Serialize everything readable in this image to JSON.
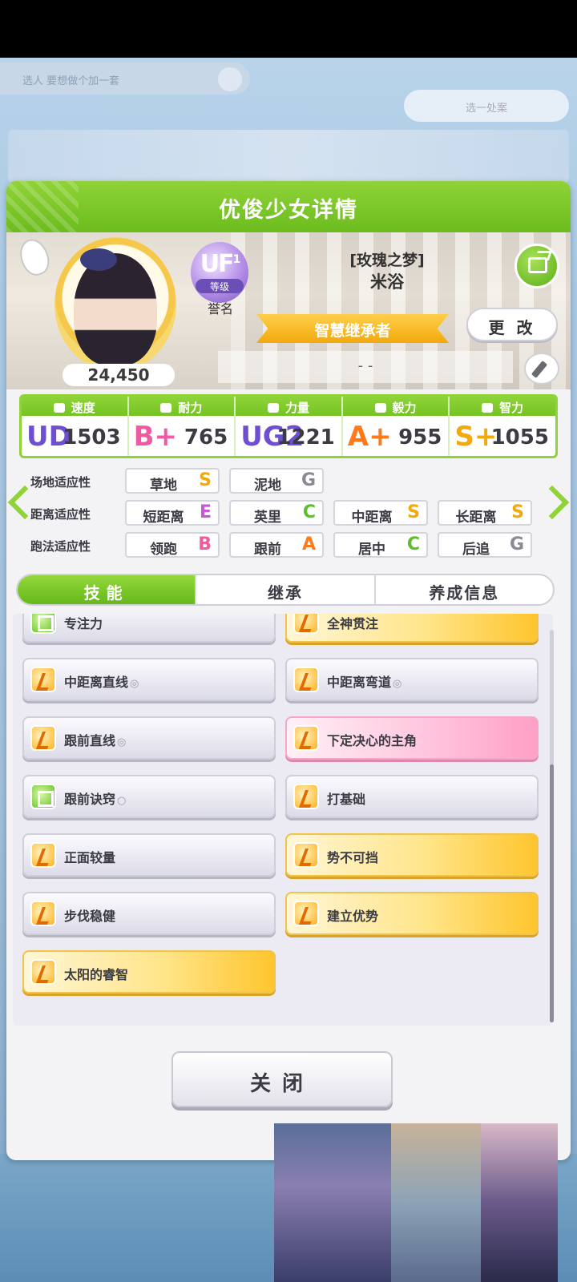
{
  "background": {
    "top_left_text": "选人 要想做个加一套",
    "top_right_button": "选一处案"
  },
  "dialog": {
    "title": "优俊少女详情"
  },
  "profile": {
    "fans": "24,450",
    "rank_badge": "UF",
    "rank_badge_sub": "1",
    "rank_label": "等级",
    "honor_label": "誉名",
    "epithet": "[玫瑰之梦]",
    "name": "米浴",
    "title": "智慧继承者",
    "change_button": "更 改",
    "motto": "- -"
  },
  "stats": [
    {
      "label": "速度",
      "grade": "UD",
      "value": "1503",
      "color": "#6e4fd1"
    },
    {
      "label": "耐力",
      "grade": "B+",
      "value": "765",
      "color": "#f05aa0"
    },
    {
      "label": "力量",
      "grade": "UG2",
      "value": "1221",
      "color": "#6e4fd1"
    },
    {
      "label": "毅力",
      "grade": "A+",
      "value": "955",
      "color": "#ff7a1a"
    },
    {
      "label": "智力",
      "grade": "S+",
      "value": "1055",
      "color": "#f2a90d"
    }
  ],
  "aptitude": {
    "rows": [
      {
        "label": "场地适应性",
        "cells": [
          {
            "name": "草地",
            "grade": "S",
            "color": "#f2a90d"
          },
          {
            "name": "泥地",
            "grade": "G",
            "color": "#8a8a96"
          }
        ]
      },
      {
        "label": "距离适应性",
        "cells": [
          {
            "name": "短距离",
            "grade": "E",
            "color": "#c45ad6"
          },
          {
            "name": "英里",
            "grade": "C",
            "color": "#5fbf2a"
          },
          {
            "name": "中距离",
            "grade": "S",
            "color": "#f2a90d"
          },
          {
            "name": "长距离",
            "grade": "S",
            "color": "#f2a90d"
          }
        ]
      },
      {
        "label": "跑法适应性",
        "cells": [
          {
            "name": "领跑",
            "grade": "B",
            "color": "#f05aa0"
          },
          {
            "name": "跟前",
            "grade": "A",
            "color": "#ff7a1a"
          },
          {
            "name": "居中",
            "grade": "C",
            "color": "#5fbf2a"
          },
          {
            "name": "后追",
            "grade": "G",
            "color": "#8a8a96"
          }
        ]
      }
    ]
  },
  "tabs": [
    {
      "label": "技能",
      "active": true
    },
    {
      "label": "继承",
      "active": false
    },
    {
      "label": "养成信息",
      "active": false
    }
  ],
  "skills": [
    {
      "name": "专注力",
      "mark": "",
      "style": "gray",
      "icon": "green"
    },
    {
      "name": "全神贯注",
      "mark": "",
      "style": "gold",
      "icon": "orange"
    },
    {
      "name": "中距离直线",
      "mark": "◎",
      "style": "gray",
      "icon": "orange"
    },
    {
      "name": "中距离弯道",
      "mark": "◎",
      "style": "gray",
      "icon": "orange"
    },
    {
      "name": "跟前直线",
      "mark": "◎",
      "style": "gray",
      "icon": "orange"
    },
    {
      "name": "下定决心的主角",
      "mark": "",
      "style": "pink",
      "icon": "orange"
    },
    {
      "name": "跟前诀窍",
      "mark": "○",
      "style": "gray",
      "icon": "green"
    },
    {
      "name": "打基础",
      "mark": "",
      "style": "gray",
      "icon": "orange"
    },
    {
      "name": "正面较量",
      "mark": "",
      "style": "gray",
      "icon": "orange"
    },
    {
      "name": "势不可挡",
      "mark": "",
      "style": "gold",
      "icon": "orange"
    },
    {
      "name": "步伐稳健",
      "mark": "",
      "style": "gray",
      "icon": "orange"
    },
    {
      "name": "建立优势",
      "mark": "",
      "style": "gold",
      "icon": "orange"
    },
    {
      "name": "太阳的睿智",
      "mark": "",
      "style": "gold",
      "icon": "orange"
    }
  ],
  "close_button": "关闭"
}
